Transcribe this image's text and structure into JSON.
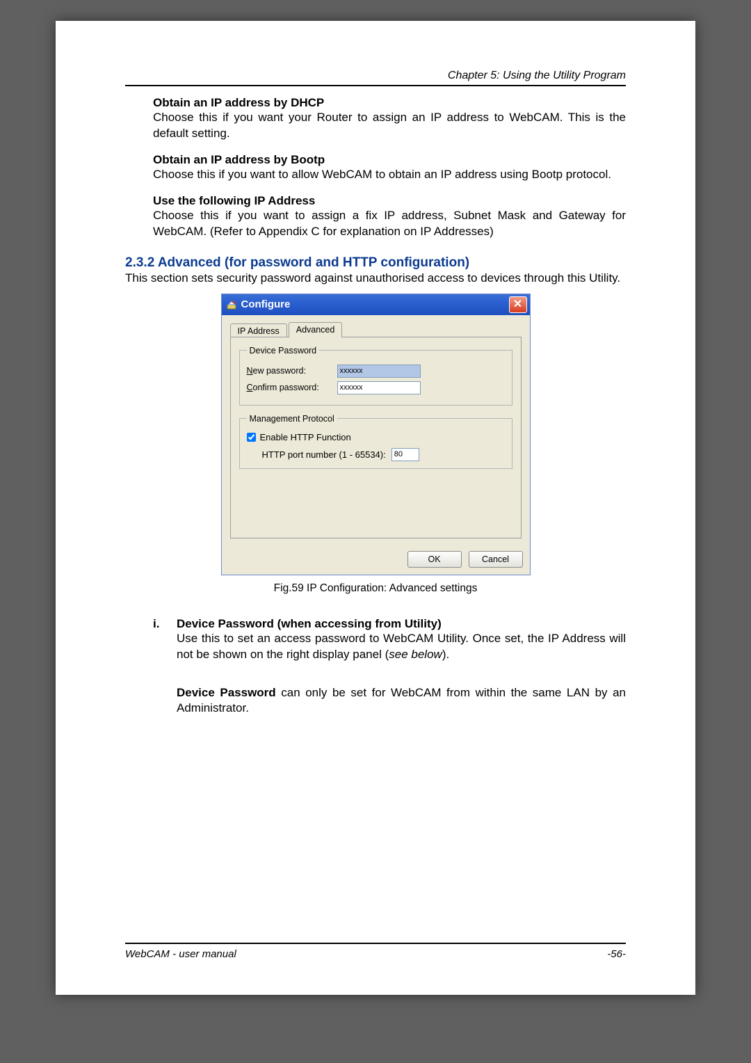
{
  "header": {
    "chapter": "Chapter 5: Using the Utility Program"
  },
  "footer": {
    "manual": "WebCAM - user manual",
    "page": "-56-"
  },
  "sec_dhcp": {
    "title": "Obtain an IP address by DHCP",
    "body": "Choose this if you want your Router to assign an IP address to WebCAM.    This is the default setting."
  },
  "sec_bootp": {
    "title": "Obtain an IP address by Bootp",
    "body": "Choose this if you want to allow WebCAM to obtain an IP address using Bootp protocol."
  },
  "sec_fixed": {
    "title": "Use the following IP Address",
    "body": "Choose this if you want to assign a fix IP address, Subnet Mask and Gateway for WebCAM.    (Refer to Appendix C for explanation on IP Addresses)"
  },
  "heading232": "2.3.2    Advanced (for password and HTTP configuration)",
  "intro232": "This section sets security password against unauthorised access to devices through this Utility.",
  "dialog": {
    "title": "Configure",
    "close_glyph": "✕",
    "tabs": {
      "ip": "IP Address",
      "adv": "Advanced"
    },
    "group_pwd": {
      "legend": "Device Password",
      "new_label_pre": "N",
      "new_label_rest": "ew password:",
      "confirm_label_pre": "C",
      "confirm_label_rest": "onfirm password:",
      "mask": "xxxxxx"
    },
    "group_mgmt": {
      "legend": "Management Protocol",
      "enable_pre": "E",
      "enable_rest": "nable HTTP Function",
      "port_pre": "H",
      "port_rest": "TTP port number (1 - 65534):",
      "port_value": "80"
    },
    "buttons": {
      "ok": "OK",
      "cancel": "Cancel"
    }
  },
  "caption": "Fig.59  IP Configuration: Advanced settings",
  "item_i": {
    "num": "i.",
    "title": "Device Password (when accessing from Utility)",
    "body_a": "Use this to set an access password to WebCAM Utility.  Once set, the IP Address will not be shown on the right display panel (",
    "body_b_italic": "see below",
    "body_c": ").",
    "note_bold": "Device Password",
    "note_rest": " can only be set for WebCAM from within the same LAN by an Administrator."
  }
}
